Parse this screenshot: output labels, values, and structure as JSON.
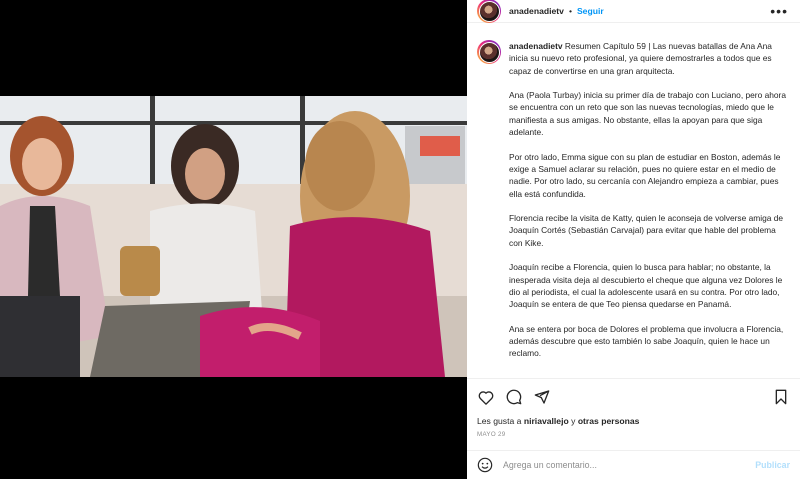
{
  "post": {
    "username": "anadenadietv",
    "separator": "•",
    "follow_label": "Seguir",
    "more_icon": "more-horizontal-icon"
  },
  "caption": {
    "username": "anadenadietv",
    "paragraphs": [
      "Resumen Capítulo 59 | Las nuevas batallas de Ana Ana inicia su nuevo reto profesional, ya quiere demostrarles a todos que es capaz de convertirse en una gran arquitecta.",
      "Ana (Paola Turbay) inicia su primer día de trabajo con Luciano, pero ahora se encuentra con un reto que son las nuevas tecnologías, miedo que le manifiesta a sus amigas. No obstante, ellas la apoyan para que siga adelante.",
      "Por otro lado, Emma sigue con su plan de estudiar en Boston, además le exige a Samuel aclarar su relación, pues no quiere estar en el medio de nadie. Por otro lado, su cercanía con Alejandro empieza a cambiar, pues ella está confundida.",
      "Florencia recibe la visita de Katty, quien le aconseja de volverse amiga de Joaquín Cortés (Sebastián Carvajal) para evitar que hable del problema con Kike.",
      "Joaquín recibe a Florencia, quien lo busca para hablar; no obstante, la inesperada visita deja al descubierto el cheque que alguna vez Dolores le dio al periodista, el cual la adolescente usará en su contra. Por otro lado, Joaquín se entera de que Teo piensa quedarse en Panamá.",
      "Ana se entera por boca de Dolores el problema que involucra a Florencia, además descubre que esto también lo sabe Joaquín, quien le hace un reclamo."
    ]
  },
  "actions": {
    "like_icon": "heart-icon",
    "comment_icon": "comment-icon",
    "share_icon": "share-icon",
    "save_icon": "bookmark-icon"
  },
  "likes": {
    "prefix": "Les gusta a",
    "user": "niriavallejo",
    "joiner": "y",
    "others": "otras personas"
  },
  "date": "MAYO 29",
  "comment": {
    "placeholder": "Agrega un comentario...",
    "post_label": "Publicar",
    "emoji_icon": "smiley-icon"
  },
  "colors": {
    "follow": "#0095f6",
    "post_disabled": "#b2dffc",
    "secondary_text": "#8e8e8e"
  }
}
